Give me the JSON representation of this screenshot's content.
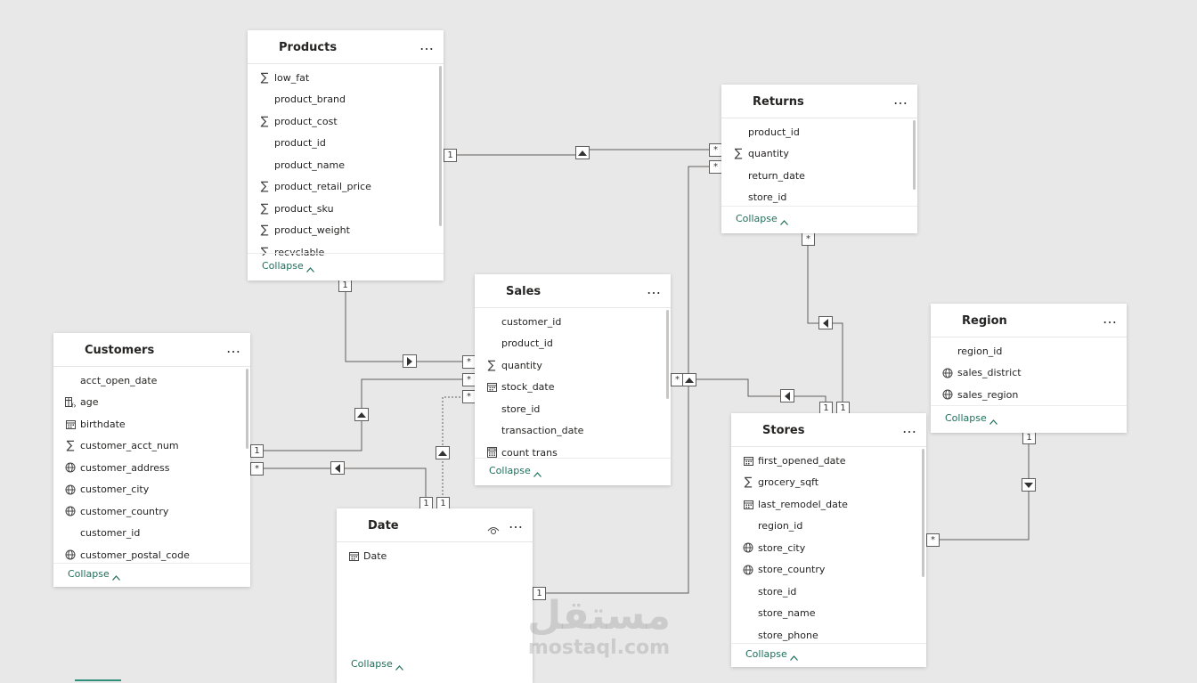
{
  "tables": [
    {
      "key": "products",
      "name": "Products",
      "collapse_label": "Collapse",
      "fields": [
        {
          "name": "low_fat",
          "icon": "sigma"
        },
        {
          "name": "product_brand",
          "icon": ""
        },
        {
          "name": "product_cost",
          "icon": "sigma"
        },
        {
          "name": "product_id",
          "icon": ""
        },
        {
          "name": "product_name",
          "icon": ""
        },
        {
          "name": "product_retail_price",
          "icon": "sigma"
        },
        {
          "name": "product_sku",
          "icon": "sigma"
        },
        {
          "name": "product_weight",
          "icon": "sigma"
        },
        {
          "name": "recyclable",
          "icon": "sigma"
        }
      ]
    },
    {
      "key": "returns",
      "name": "Returns",
      "collapse_label": "Collapse",
      "fields": [
        {
          "name": "product_id",
          "icon": ""
        },
        {
          "name": "quantity",
          "icon": "sigma"
        },
        {
          "name": "return_date",
          "icon": ""
        },
        {
          "name": "store_id",
          "icon": ""
        }
      ]
    },
    {
      "key": "sales",
      "name": "Sales",
      "collapse_label": "Collapse",
      "fields": [
        {
          "name": "customer_id",
          "icon": ""
        },
        {
          "name": "product_id",
          "icon": ""
        },
        {
          "name": "quantity",
          "icon": "sigma"
        },
        {
          "name": "stock_date",
          "icon": "calendar"
        },
        {
          "name": "store_id",
          "icon": ""
        },
        {
          "name": "transaction_date",
          "icon": ""
        },
        {
          "name": "count trans",
          "icon": "calculator"
        }
      ]
    },
    {
      "key": "region",
      "name": "Region",
      "collapse_label": "Collapse",
      "fields": [
        {
          "name": "region_id",
          "icon": ""
        },
        {
          "name": "sales_district",
          "icon": "globe"
        },
        {
          "name": "sales_region",
          "icon": "globe"
        }
      ]
    },
    {
      "key": "customers",
      "name": "Customers",
      "collapse_label": "Collapse",
      "fields": [
        {
          "name": "acct_open_date",
          "icon": ""
        },
        {
          "name": "age",
          "icon": "calc-column"
        },
        {
          "name": "birthdate",
          "icon": "calendar"
        },
        {
          "name": "customer_acct_num",
          "icon": "sigma"
        },
        {
          "name": "customer_address",
          "icon": "globe"
        },
        {
          "name": "customer_city",
          "icon": "globe"
        },
        {
          "name": "customer_country",
          "icon": "globe"
        },
        {
          "name": "customer_id",
          "icon": ""
        },
        {
          "name": "customer_postal_code",
          "icon": "globe"
        }
      ]
    },
    {
      "key": "stores",
      "name": "Stores",
      "collapse_label": "Collapse",
      "fields": [
        {
          "name": "first_opened_date",
          "icon": "calendar"
        },
        {
          "name": "grocery_sqft",
          "icon": "sigma"
        },
        {
          "name": "last_remodel_date",
          "icon": "calendar"
        },
        {
          "name": "region_id",
          "icon": ""
        },
        {
          "name": "store_city",
          "icon": "globe"
        },
        {
          "name": "store_country",
          "icon": "globe"
        },
        {
          "name": "store_id",
          "icon": ""
        },
        {
          "name": "store_name",
          "icon": ""
        },
        {
          "name": "store_phone",
          "icon": ""
        }
      ]
    },
    {
      "key": "date",
      "name": "Date",
      "collapse_label": "Collapse",
      "fields": [
        {
          "name": "Date",
          "icon": "calendar"
        }
      ]
    }
  ],
  "cardinality": {
    "one": "1",
    "many": "*"
  },
  "watermark": {
    "arabic": "مستقل",
    "latin": "mostaql.com"
  },
  "colors": {
    "canvas": "#e8e8e8",
    "line": "#605e5c",
    "collapse_link": "#1f6f5c"
  }
}
